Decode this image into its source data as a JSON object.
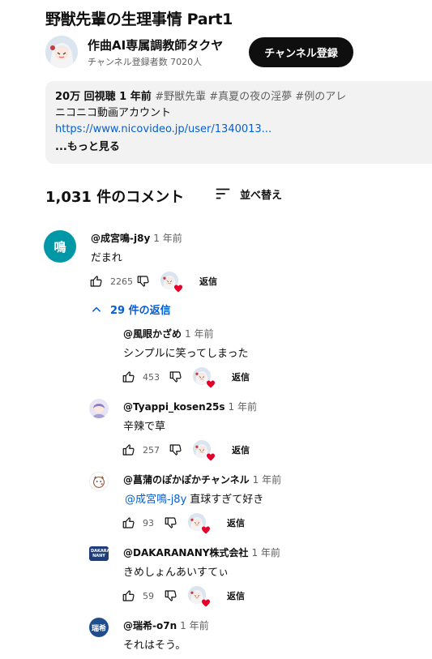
{
  "video": {
    "title": "野獣先輩の生理事情 Part1"
  },
  "channel": {
    "name": "作曲AI専属調教師タクヤ",
    "subscribers": "チャンネル登録者数 7020人",
    "subscribe_label": "チャンネル登録"
  },
  "description": {
    "stats": "20万 回視聴  1 年前",
    "tags": "#野獣先輩 #真夏の夜の淫夢 #例のアレ",
    "line2": "ニコニコ動画アカウント",
    "link": "https://www.nicovideo.jp/user/1340013...",
    "more": "...もっと見る"
  },
  "comments_section": {
    "count_label": "1,031 件のコメント",
    "sort_label": "並べ替え"
  },
  "top_comment": {
    "avatar_text": "鳴",
    "author": "@成宮鳴-j8y",
    "time": "1 年前",
    "text": "だまれ",
    "likes": "2265",
    "reply_label": "返信",
    "avatar_color": "#0097a7"
  },
  "replies_toggle": {
    "label": "29 件の返信"
  },
  "replies": [
    {
      "author": "@風眼かざめ",
      "time": "1 年前",
      "text": "シンプルに笑ってしまった",
      "likes": "453",
      "reply_label": "返信"
    },
    {
      "author": "@Tyappi_kosen25s",
      "time": "1 年前",
      "text": "辛辣で草",
      "likes": "257",
      "reply_label": "返信"
    },
    {
      "author": "@菖蒲のぽかぽかチャンネル",
      "time": "1 年前",
      "mention": "@成宮鳴-j8y",
      "text": "直球すぎて好き",
      "likes": "93",
      "reply_label": "返信"
    },
    {
      "author": "@DAKARANANY株式会社",
      "time": "1 年前",
      "text": "きめしょんあいすてぃ",
      "likes": "59",
      "reply_label": "返信",
      "avatar_text": "DAKARA NANY"
    },
    {
      "author": "@瑞希-o7n",
      "time": "1 年前",
      "text": "それはそう。",
      "avatar_text": "瑞希",
      "avatar_color": "#1f4e8c"
    }
  ],
  "colors": {
    "link": "#065fd4",
    "heart": "#e4002b"
  }
}
